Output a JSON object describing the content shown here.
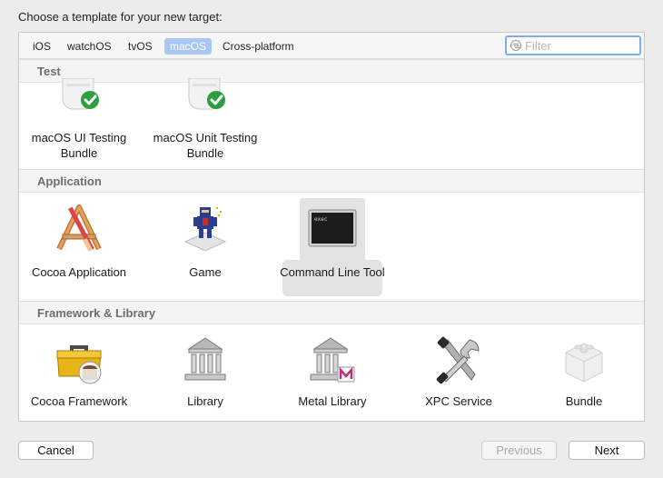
{
  "dialog": {
    "prompt": "Choose a template for your new target:"
  },
  "platform_tabs": [
    {
      "label": "iOS",
      "selected": false
    },
    {
      "label": "watchOS",
      "selected": false
    },
    {
      "label": "tvOS",
      "selected": false
    },
    {
      "label": "macOS",
      "selected": true
    },
    {
      "label": "Cross-platform",
      "selected": false
    }
  ],
  "filter": {
    "placeholder": "Filter",
    "value": ""
  },
  "sections": {
    "test": {
      "title": "Test",
      "items": [
        {
          "label": "macOS UI Testing Bundle",
          "icon": "test-bundle-icon"
        },
        {
          "label": "macOS Unit Testing Bundle",
          "icon": "test-bundle-icon"
        }
      ]
    },
    "application": {
      "title": "Application",
      "items": [
        {
          "label": "Cocoa Application",
          "icon": "cocoa-app-icon"
        },
        {
          "label": "Game",
          "icon": "game-icon"
        },
        {
          "label": "Command Line Tool",
          "icon": "terminal-icon",
          "selected": true
        }
      ]
    },
    "framework": {
      "title": "Framework & Library",
      "items": [
        {
          "label": "Cocoa Framework",
          "icon": "toolbox-icon"
        },
        {
          "label": "Library",
          "icon": "library-icon"
        },
        {
          "label": "Metal Library",
          "icon": "metal-library-icon"
        },
        {
          "label": "XPC Service",
          "icon": "wrench-screwdriver-icon"
        },
        {
          "label": "Bundle",
          "icon": "bundle-icon"
        }
      ]
    }
  },
  "terminal_text": "exec",
  "buttons": {
    "cancel": "Cancel",
    "previous": "Previous",
    "next": "Next"
  },
  "colors": {
    "accent": "#7eaef0",
    "tab_selected": "#a9c7f5",
    "check_green": "#2e9e3e"
  }
}
